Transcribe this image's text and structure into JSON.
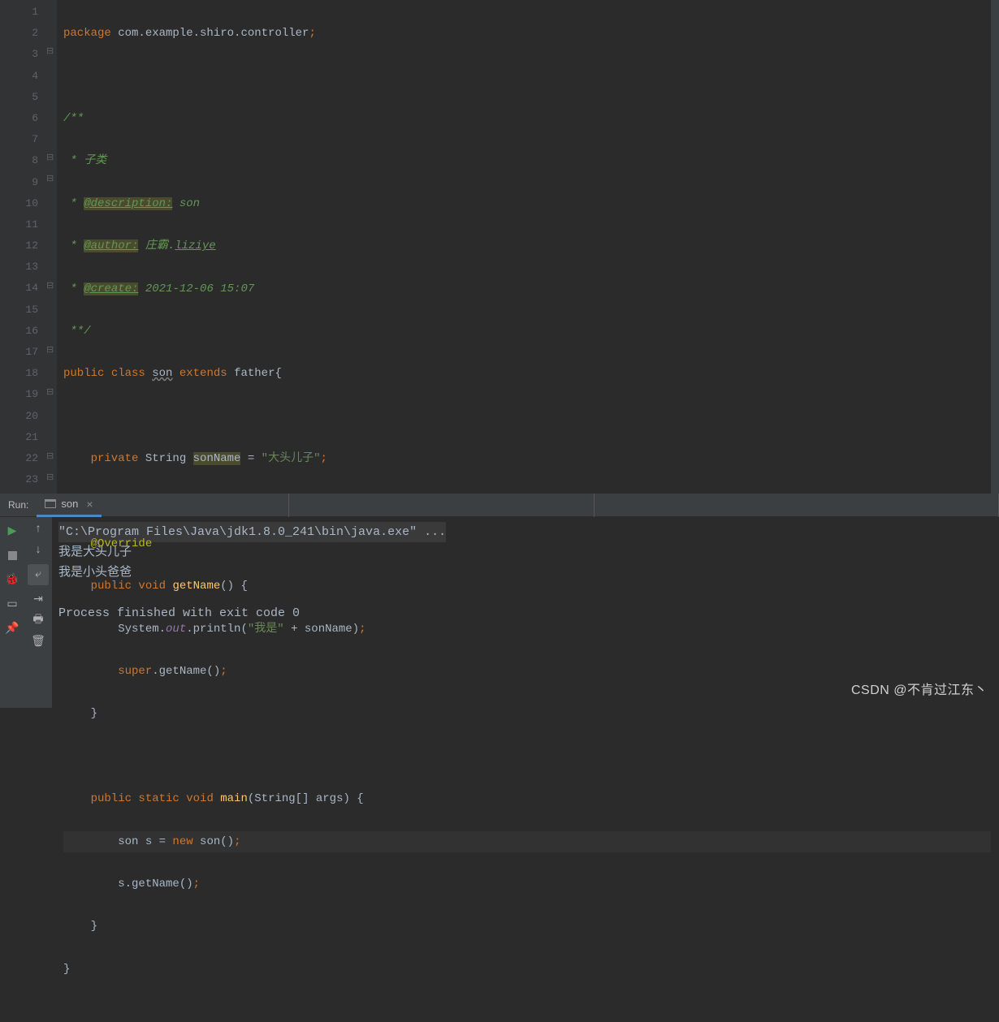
{
  "code": {
    "l1": {
      "package": "package",
      "pkg_path": " com.example.shiro.controller",
      "semi": ";"
    },
    "l3": "/**",
    "l4_pre": " * ",
    "l4_txt": "子类",
    "l5_pre": " * ",
    "l5_tag": "@description:",
    "l5_txt": " son",
    "l6_pre": " * ",
    "l6_tag": "@author:",
    "l6_txt1": " 庄霸.",
    "l6_link": "liziye",
    "l7_pre": " * ",
    "l7_tag": "@create:",
    "l7_txt": " 2021-12-06 15:07",
    "l8": " **/",
    "l9_1": "public",
    "l9_2": " class ",
    "l9_3": "son",
    "l9_4": " extends ",
    "l9_5": "father{",
    "l11_1": "    private",
    "l11_2": " String ",
    "l11_3": "sonName",
    "l11_4": " = ",
    "l11_5": "\"大头儿子\"",
    "l11_6": ";",
    "l13": "    @Override",
    "l14_1": "    public",
    "l14_2": " void ",
    "l14_3": "getName",
    "l14_4": "() {",
    "l15_1": "        System.",
    "l15_2": "out",
    "l15_3": ".println(",
    "l15_4": "\"我是\"",
    "l15_5": " + sonName)",
    "l15_6": ";",
    "l16_1": "        super",
    "l16_2": ".getName()",
    "l16_3": ";",
    "l17": "    }",
    "l19_1": "    public",
    "l19_2": " static ",
    "l19_3": "void ",
    "l19_4": "main",
    "l19_5": "(String[] args) {",
    "l20_1": "        son s = ",
    "l20_2": "new",
    "l20_3": " son()",
    "l20_4": ";",
    "l21_1": "        s.getName()",
    "l21_2": ";",
    "l22": "    }",
    "l23": "}"
  },
  "gutter": {
    "lines": [
      "1",
      "2",
      "3",
      "4",
      "5",
      "6",
      "7",
      "8",
      "9",
      "10",
      "11",
      "12",
      "13",
      "14",
      "15",
      "16",
      "17",
      "18",
      "19",
      "20",
      "21",
      "22",
      "23"
    ]
  },
  "run": {
    "label": "Run:",
    "tab_name": "son",
    "output_l1": "\"C:\\Program Files\\Java\\jdk1.8.0_241\\bin\\java.exe\" ...",
    "output_l2": "我是大头儿子",
    "output_l3": "我是小头爸爸",
    "output_l4": "Process finished with exit code 0"
  },
  "watermark": "CSDN @不肯过江东丶"
}
